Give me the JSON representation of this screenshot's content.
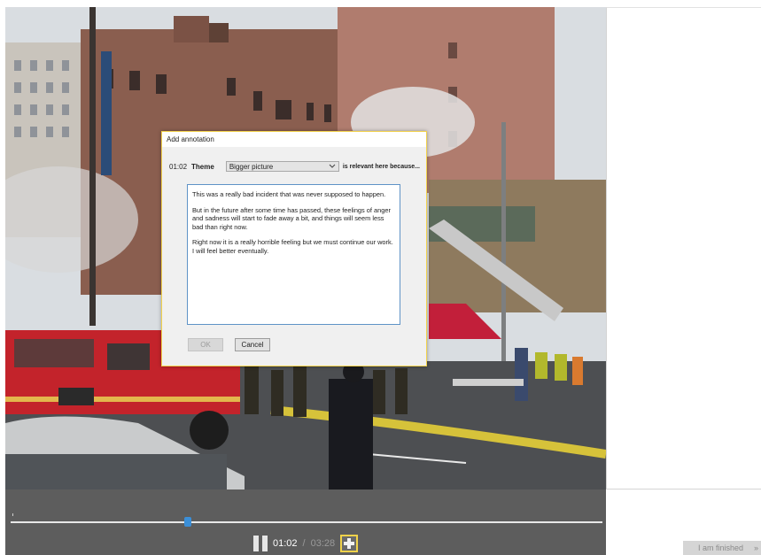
{
  "video": {
    "scene_description_icon": "street-scene-video-frame"
  },
  "dialog": {
    "title": "Add annotation",
    "time": "01:02",
    "theme_label": "Theme",
    "theme_value": "Bigger picture",
    "suffix": "is relevant here because...",
    "text_paragraphs": [
      "This was a really bad incident that was never supposed to happen.",
      "But in the future after some time has passed, these feelings of anger and sadness will start to fade away a bit, and things will seem less bad than right now.",
      "Right now it is a really horrible feeling but we must continue our work.  I will feel better eventually."
    ],
    "ok_label": "OK",
    "cancel_label": "Cancel"
  },
  "player": {
    "current_time": "01:02",
    "separator": "/",
    "total_time": "03:28",
    "progress_fraction": 0.3
  },
  "finish": {
    "label": "I am finished",
    "arrow": "»"
  },
  "colors": {
    "accent_yellow": "#f2d24c",
    "timeline_handle": "#3b8fd8",
    "controls_bg": "#5d5d5d"
  }
}
